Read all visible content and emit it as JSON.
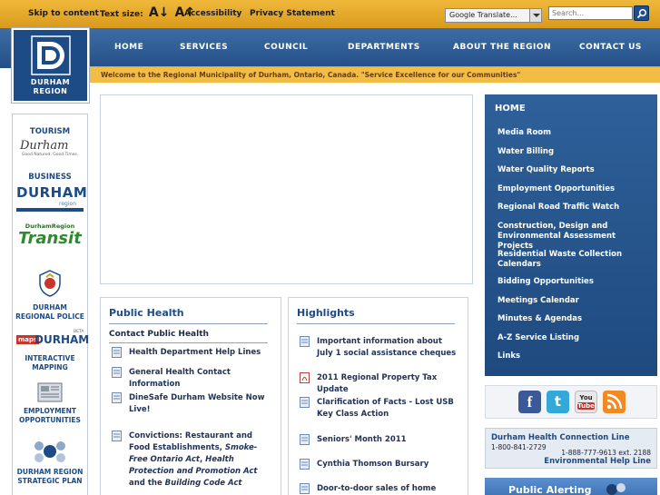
{
  "topbar": {
    "skip": "Skip to content",
    "text_size": "Text size:",
    "text_size_smaller": "A↓",
    "text_size_larger": "A↑",
    "accessibility": "Accessibility",
    "privacy": "Privacy Statement",
    "translate": "Google Translate...",
    "search_placeholder": "Search..."
  },
  "logo": {
    "line1": "DURHAM",
    "line2": "REGION"
  },
  "nav": [
    "HOME",
    "SERVICES",
    "COUNCIL",
    "DEPARTMENTS",
    "ABOUT THE REGION",
    "CONTACT US"
  ],
  "welcome": "Welcome to the Regional Municipality of Durham, Ontario, Canada.   \"Service Excellence for our Communities\"",
  "left": {
    "tourism": "TOURISM",
    "tourism_logo": "Durham",
    "tourism_tag": "Good Natured. Good Times.",
    "business": "BUSINESS",
    "business_logo": "DURHAM",
    "business_sub": "region",
    "transit_top": "DurhamRegion",
    "transit": "Transit",
    "police1": "DURHAM",
    "police2": "REGIONAL POLICE",
    "maps_badge": "maps",
    "maps_logo": "DURHAM",
    "maps_beta": "BETA",
    "mapping1": "INTERACTIVE",
    "mapping2": "MAPPING",
    "emp1": "EMPLOYMENT",
    "emp2": "OPPORTUNITIES",
    "plan1": "DURHAM REGION",
    "plan2": "STRATEGIC PLAN"
  },
  "health": {
    "title": "Public Health",
    "subtitle": "Contact Public Health",
    "items": [
      "Health Department Help Lines",
      "General Health Contact Information",
      "DineSafe Durham Website Now Live!"
    ],
    "conv_prefix": "Convictions: Restaurant and Food Establishments, ",
    "conv_it1": "Smoke-Free Ontario Act",
    "conv_mid": ", ",
    "conv_it2": "Health Protection and Promotion Act",
    "conv_and": " and the ",
    "conv_it3": "Building Code Act"
  },
  "highlights": {
    "title": "Highlights",
    "items": [
      "Important information about July 1 social assistance cheques",
      "2011 Regional Property Tax Update",
      "Clarification of Facts - Lost USB Key Class Action",
      "Seniors' Month 2011",
      "Cynthia Thomson Bursary",
      "Door-to-door sales of home water"
    ]
  },
  "rightnav": {
    "home": "HOME",
    "items": [
      "Media Room",
      "Water Billing",
      "Water Quality Reports",
      "Employment Opportunities",
      "Regional Road Traffic Watch",
      "Construction, Design and Environmental Assessment Projects",
      "Residential Waste Collection Calendars",
      "Bidding Opportunities",
      "Meetings Calendar",
      "Minutes & Agendas",
      "A-Z Service Listing",
      "Links"
    ]
  },
  "social": {
    "facebook": "f",
    "twitter": "t",
    "youtube_top": "You",
    "youtube_bottom": "Tube"
  },
  "contact": {
    "title": "Durham Health Connection Line",
    "phone1": "1-800-841-2729",
    "phone2": "1-888-777-9613 ext. 2188",
    "env": "Environmental Help Line"
  },
  "alert": "Public Alerting",
  "colors": {
    "navy": "#1c4b85",
    "gold": "#f2bd45",
    "topbar": "#e0a52a"
  }
}
